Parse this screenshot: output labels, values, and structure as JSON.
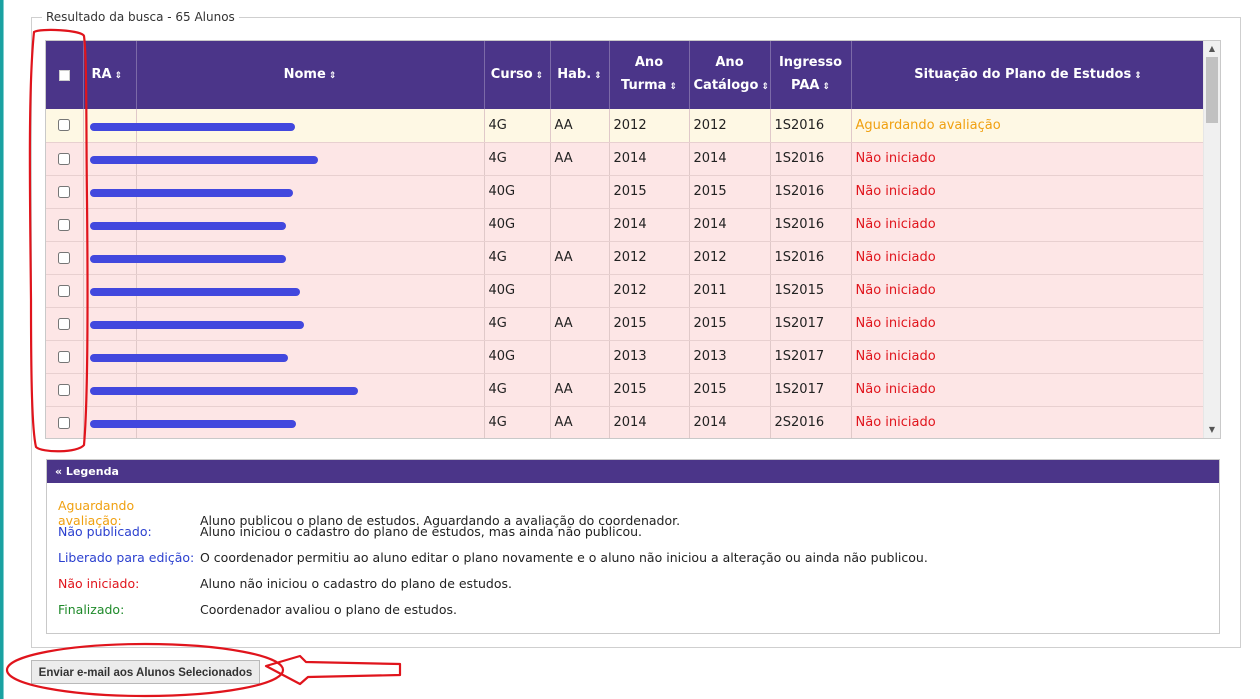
{
  "results": {
    "legend_title": "Resultado da busca - 65 Alunos",
    "columns": [
      {
        "label": "RA"
      },
      {
        "label": "Nome"
      },
      {
        "label": "Curso"
      },
      {
        "label": "Hab."
      },
      {
        "label": "Ano Turma"
      },
      {
        "label": "Ano Catálogo"
      },
      {
        "label": "Ingresso PAA"
      },
      {
        "label": "Situação do Plano de Estudos"
      }
    ],
    "rows": [
      {
        "curso": "4G",
        "hab": "AA",
        "ano_turma": "2012",
        "ano_catalogo": "2012",
        "ingresso": "1S2016",
        "status": "Aguardando avaliação",
        "kind": "yellow"
      },
      {
        "curso": "4G",
        "hab": "AA",
        "ano_turma": "2014",
        "ano_catalogo": "2014",
        "ingresso": "1S2016",
        "status": "Não iniciado",
        "kind": "pink"
      },
      {
        "curso": "40G",
        "hab": "",
        "ano_turma": "2015",
        "ano_catalogo": "2015",
        "ingresso": "1S2016",
        "status": "Não iniciado",
        "kind": "pink"
      },
      {
        "curso": "40G",
        "hab": "",
        "ano_turma": "2014",
        "ano_catalogo": "2014",
        "ingresso": "1S2016",
        "status": "Não iniciado",
        "kind": "pink"
      },
      {
        "curso": "4G",
        "hab": "AA",
        "ano_turma": "2012",
        "ano_catalogo": "2012",
        "ingresso": "1S2016",
        "status": "Não iniciado",
        "kind": "pink"
      },
      {
        "curso": "40G",
        "hab": "",
        "ano_turma": "2012",
        "ano_catalogo": "2011",
        "ingresso": "1S2015",
        "status": "Não iniciado",
        "kind": "pink"
      },
      {
        "curso": "4G",
        "hab": "AA",
        "ano_turma": "2015",
        "ano_catalogo": "2015",
        "ingresso": "1S2017",
        "status": "Não iniciado",
        "kind": "pink"
      },
      {
        "curso": "40G",
        "hab": "",
        "ano_turma": "2013",
        "ano_catalogo": "2013",
        "ingresso": "1S2017",
        "status": "Não iniciado",
        "kind": "pink"
      },
      {
        "curso": "4G",
        "hab": "AA",
        "ano_turma": "2015",
        "ano_catalogo": "2015",
        "ingresso": "1S2017",
        "status": "Não iniciado",
        "kind": "pink"
      },
      {
        "curso": "4G",
        "hab": "AA",
        "ano_turma": "2014",
        "ano_catalogo": "2014",
        "ingresso": "2S2016",
        "status": "Não iniciado",
        "kind": "pink"
      }
    ]
  },
  "legend": {
    "title": "« Legenda",
    "items": [
      {
        "term": "Aguardando avaliação:",
        "desc": "Aluno publicou o plano de estudos. Aguardando a avaliação do coordenador.",
        "color": "#f0a010"
      },
      {
        "term": "Não publicado:",
        "desc": "Aluno iniciou o cadastro do plano de estudos, mas ainda não publicou.",
        "color": "#2a3fcf"
      },
      {
        "term": "Liberado para edição:",
        "desc": "O coordenador permitiu ao aluno editar o plano novamente e o aluno não iniciou a alteração ou ainda não publicou.",
        "color": "#2a3fcf"
      },
      {
        "term": "Não iniciado:",
        "desc": "Aluno não iniciou o cadastro do plano de estudos.",
        "color": "#e0141c"
      },
      {
        "term": "Finalizado:",
        "desc": "Coordenador avaliou o plano de estudos.",
        "color": "#1f8a2a"
      }
    ]
  },
  "actions": {
    "email_button_label": "Enviar e-mail aos Alunos Selecionados"
  },
  "colors": {
    "header_bg": "#4b3589",
    "row_pink": "#fde6e6",
    "row_yellow": "#fef8e4",
    "annotation_red": "#e0141c",
    "redaction_blue": "#4248de"
  }
}
